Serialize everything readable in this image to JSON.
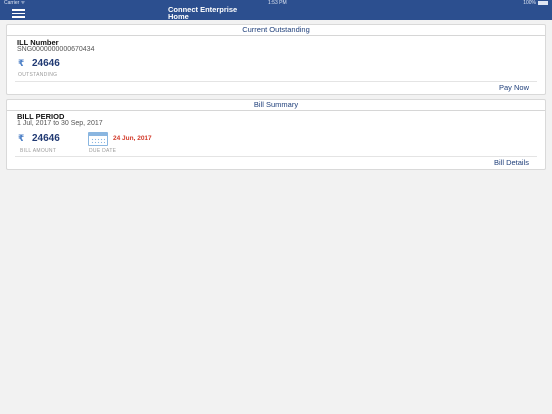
{
  "status_bar": {
    "carrier": "Carrier ᯤ",
    "time": "1:53 PM",
    "battery": "100%"
  },
  "nav": {
    "title_line1": "Connect Enterprise",
    "title_line2": "Home"
  },
  "outstanding": {
    "header": "Current Outstanding",
    "bill_number_label": "ILL Number",
    "bill_number": "SNG0000000000670434",
    "currency": "₹",
    "amount": "24646",
    "amount_caption": "OUTSTANDING",
    "action_label": "Pay Now"
  },
  "summary": {
    "header": "Bill Summary",
    "period_label": "BILL PERIOD",
    "period": "1 Jul, 2017 to 30 Sep, 2017",
    "currency": "₹",
    "amount": "24646",
    "amount_caption": "BILL AMOUNT",
    "due_date": "24 Jun, 2017",
    "due_caption": "DUE DATE",
    "action_label": "Bill Details"
  },
  "colors": {
    "nav": "#2c4f8f",
    "accent": "#1f3f7a",
    "due": "#d23a2a"
  }
}
